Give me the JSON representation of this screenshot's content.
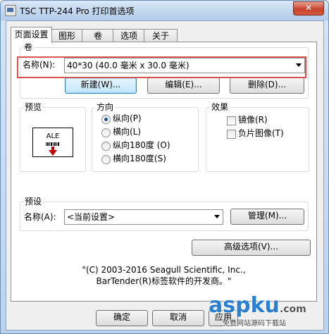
{
  "window": {
    "title": "TSC TTP-244 Pro 打印首选项",
    "close_label": "✕"
  },
  "tabs": [
    {
      "label": "页面设置",
      "active": true
    },
    {
      "label": "图形",
      "active": false
    },
    {
      "label": "卷",
      "active": false
    },
    {
      "label": "选项",
      "active": false
    },
    {
      "label": "关于",
      "active": false
    }
  ],
  "roll": {
    "group_label": "卷",
    "name_label": "名称(N):",
    "name_value": "40*30 (40.0 毫米 x 30.0 毫米)",
    "new_button": "新建(W)...",
    "edit_button": "编辑(E)...",
    "delete_button": "删除(D)..."
  },
  "preview": {
    "group_label": "预览",
    "sample_text": "ALE"
  },
  "orientation": {
    "group_label": "方向",
    "options": [
      {
        "label": "纵向(P)",
        "selected": true
      },
      {
        "label": "横向(L)",
        "selected": false
      },
      {
        "label": "纵向180度 (O)",
        "selected": false
      },
      {
        "label": "横向180度(S)",
        "selected": false
      }
    ]
  },
  "effects": {
    "group_label": "效果",
    "options": [
      {
        "label": "镜像(R)",
        "checked": false
      },
      {
        "label": "负片图像(T)",
        "checked": false
      }
    ]
  },
  "preset": {
    "group_label": "预设",
    "name_label": "名称(A):",
    "name_value": "<当前设置>",
    "manage_button": "管理(M)..."
  },
  "advanced_button": "高级选项(V)...",
  "copyright": {
    "line1": "\"(C) 2003-2016 Seagull Scientific, Inc.,",
    "line2": "BarTender(R)标签软件的开发商。\""
  },
  "dialog_buttons": {
    "ok": "确定",
    "cancel": "取消",
    "apply": "应用"
  },
  "watermark": {
    "main": "aspku",
    "suffix": ".com",
    "subtitle": "免费网站源码下载站"
  },
  "colors": {
    "highlight_box": "#d9534f",
    "selected_radio": "#1e4e8c",
    "watermark_blue": "#2a7fd0"
  }
}
